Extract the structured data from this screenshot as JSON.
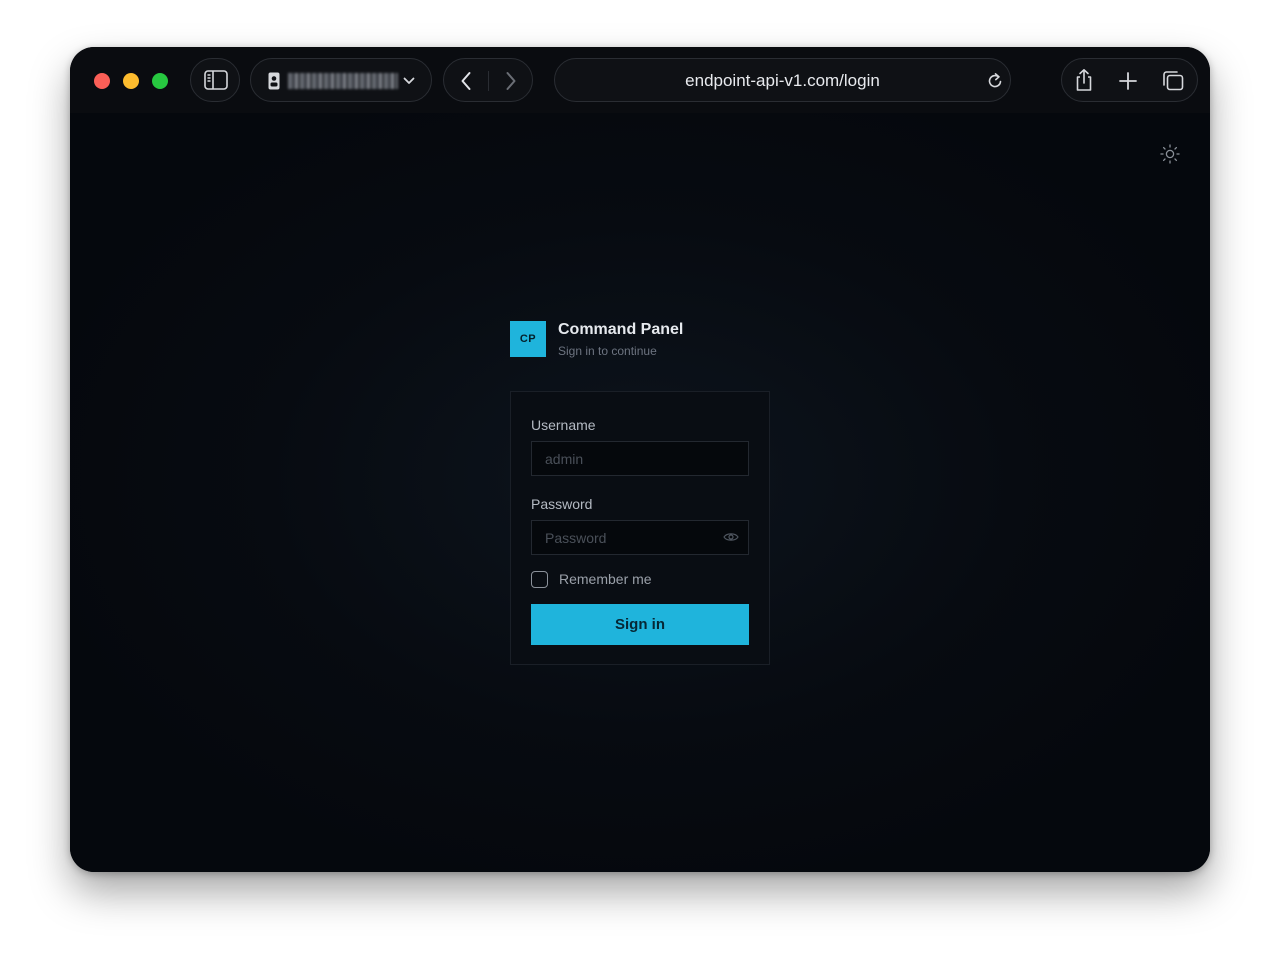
{
  "browser": {
    "tab_group_label": "",
    "url": "endpoint-api-v1.com/login",
    "icons": {
      "sidebar": "sidebar-icon",
      "tab_group": "profile-icon",
      "back": "chevron-left-icon",
      "forward": "chevron-right-icon",
      "reload": "reload-icon",
      "share": "share-icon",
      "new_tab": "plus-icon",
      "tabs": "tabs-overview-icon"
    }
  },
  "page": {
    "theme_toggle_icon": "sun-icon",
    "brand": {
      "logo_text": "CP",
      "title": "Command Panel",
      "subtitle": "Sign in to continue"
    },
    "form": {
      "username_label": "Username",
      "username_placeholder": "admin",
      "password_label": "Password",
      "password_placeholder": "Password",
      "remember_label": "Remember me",
      "submit_label": "Sign in"
    }
  },
  "colors": {
    "accent": "#1fb4dc",
    "background": "#05080d",
    "card": "#090d13"
  }
}
